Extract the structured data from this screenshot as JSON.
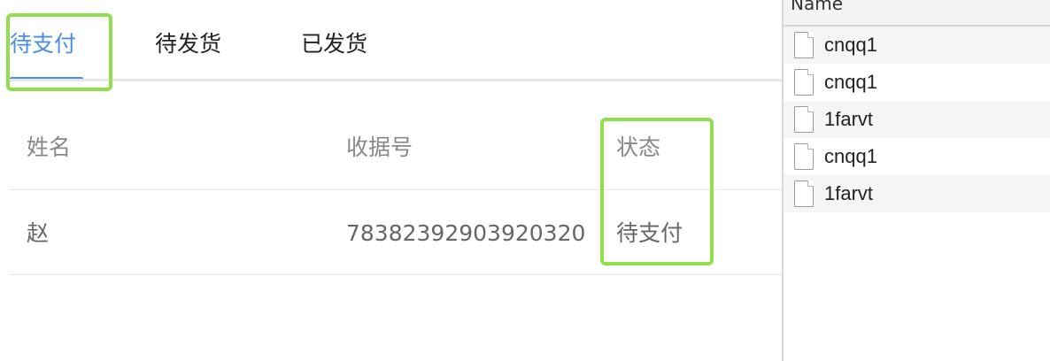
{
  "tabs": [
    {
      "label": "待支付",
      "active": true
    },
    {
      "label": "待发货",
      "active": false
    },
    {
      "label": "已发货",
      "active": false
    }
  ],
  "table": {
    "headers": {
      "name": "姓名",
      "receipt": "收据号",
      "status": "状态"
    },
    "rows": [
      {
        "name": "赵",
        "receipt": "78382392903920320",
        "status": "待支付"
      }
    ]
  },
  "network_panel": {
    "header": "Name",
    "requests": [
      {
        "name": "cnqq1",
        "icon": "file-icon"
      },
      {
        "name": "cnqq1",
        "icon": "file-icon"
      },
      {
        "name": "1farvt",
        "icon": "file-icon"
      },
      {
        "name": "cnqq1",
        "icon": "file-icon"
      },
      {
        "name": "1farvt",
        "icon": "file-icon"
      }
    ]
  },
  "colors": {
    "accent": "#4a90e2",
    "highlight": "#8fe04a"
  }
}
